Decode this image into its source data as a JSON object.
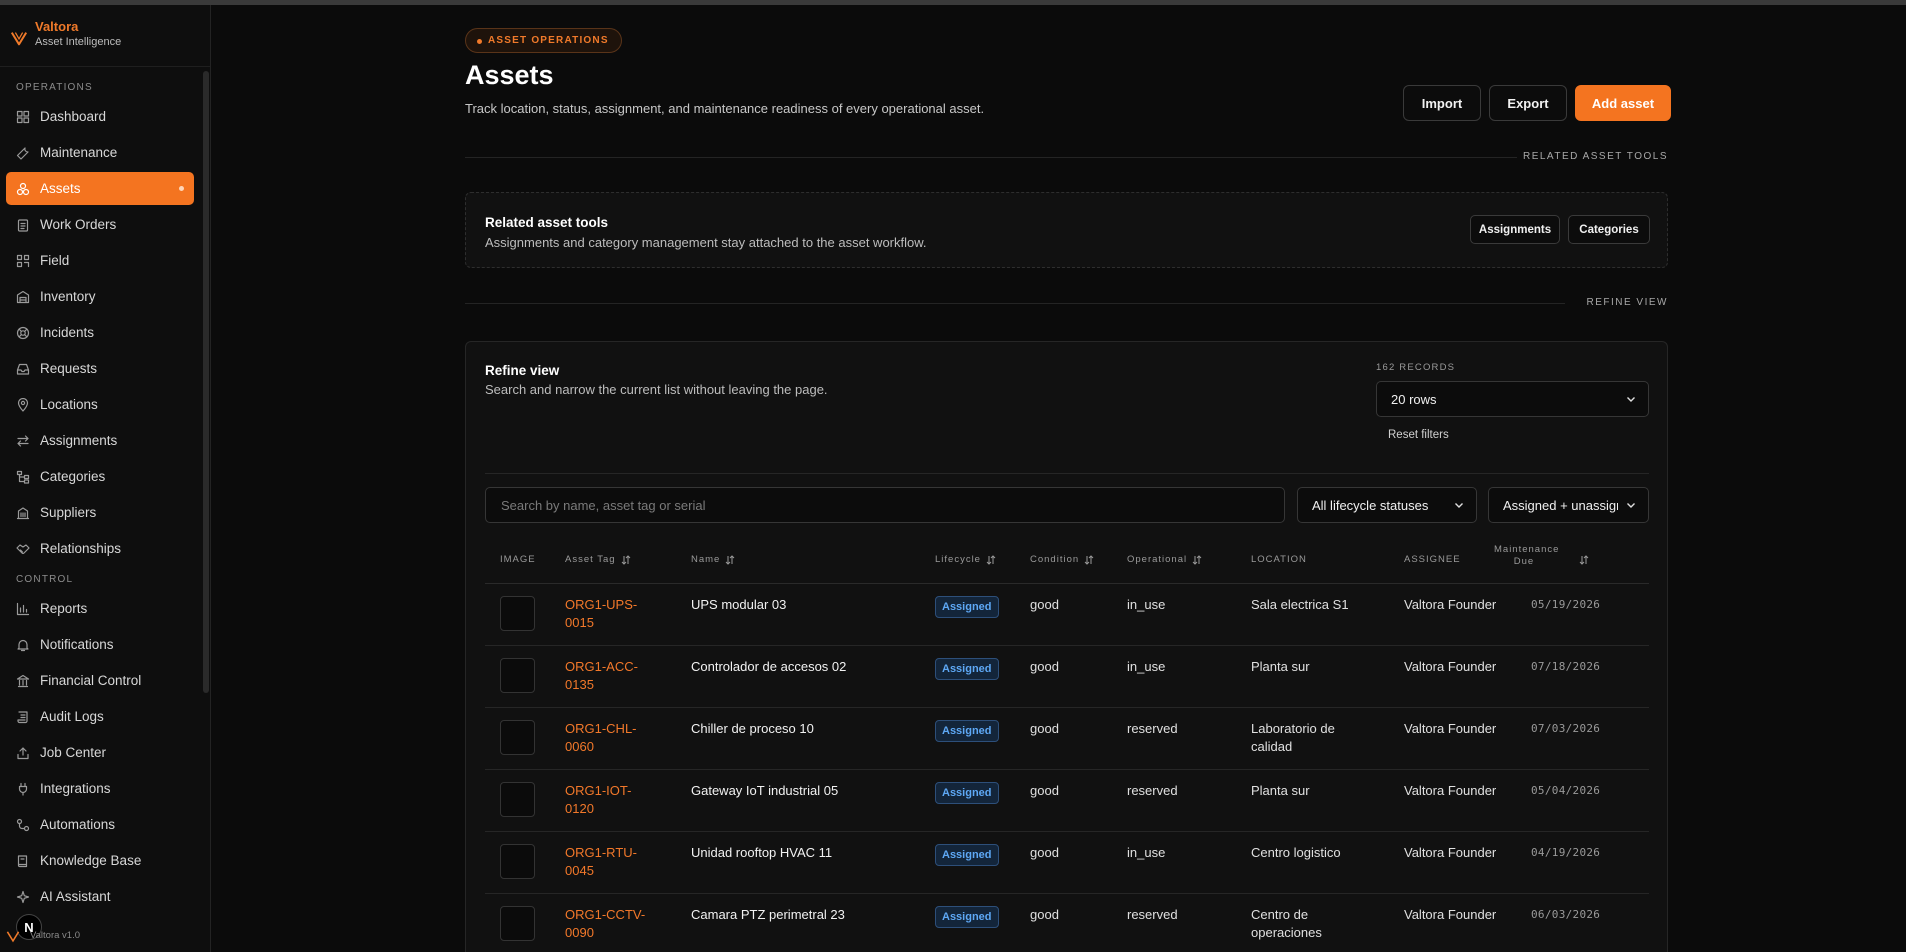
{
  "brand": {
    "name": "Valtora",
    "subtitle": "Asset Intelligence",
    "version": "Valtora v1.0",
    "accent": "#f47420"
  },
  "sidebar": {
    "sections": [
      {
        "label": "OPERATIONS",
        "items": [
          {
            "label": "Dashboard",
            "icon": "grid-icon"
          },
          {
            "label": "Maintenance",
            "icon": "wrench-icon"
          },
          {
            "label": "Assets",
            "icon": "boxes-icon",
            "active": true
          },
          {
            "label": "Work Orders",
            "icon": "clipboard-icon"
          },
          {
            "label": "Field",
            "icon": "qr-icon"
          },
          {
            "label": "Inventory",
            "icon": "warehouse-icon"
          },
          {
            "label": "Incidents",
            "icon": "lifebuoy-icon"
          },
          {
            "label": "Requests",
            "icon": "inbox-icon"
          },
          {
            "label": "Locations",
            "icon": "map-pin-icon"
          },
          {
            "label": "Assignments",
            "icon": "arrows-icon"
          },
          {
            "label": "Categories",
            "icon": "tree-icon"
          },
          {
            "label": "Suppliers",
            "icon": "building-icon"
          },
          {
            "label": "Relationships",
            "icon": "handshake-icon"
          }
        ]
      },
      {
        "label": "CONTROL",
        "items": [
          {
            "label": "Reports",
            "icon": "bar-chart-icon"
          },
          {
            "label": "Notifications",
            "icon": "bell-icon"
          },
          {
            "label": "Financial Control",
            "icon": "bank-icon"
          },
          {
            "label": "Audit Logs",
            "icon": "scroll-icon"
          },
          {
            "label": "Job Center",
            "icon": "upload-icon"
          },
          {
            "label": "Integrations",
            "icon": "plug-icon"
          },
          {
            "label": "Automations",
            "icon": "workflow-icon"
          },
          {
            "label": "Knowledge Base",
            "icon": "book-icon"
          },
          {
            "label": "AI Assistant",
            "icon": "sparkle-icon"
          }
        ]
      }
    ]
  },
  "header": {
    "eyebrow": "ASSET OPERATIONS",
    "title": "Assets",
    "subtitle": "Track location, status, assignment, and maintenance readiness of every operational asset.",
    "import_label": "Import",
    "export_label": "Export",
    "add_label": "Add asset"
  },
  "related_tools": {
    "section_label": "RELATED ASSET TOOLS",
    "title": "Related asset tools",
    "description": "Assignments and category management stay attached to the asset workflow.",
    "assignments_label": "Assignments",
    "categories_label": "Categories"
  },
  "refine": {
    "section_label": "REFINE VIEW",
    "title": "Refine view",
    "description": "Search and narrow the current list without leaving the page.",
    "records": "162 RECORDS",
    "rows_select": "20 rows",
    "reset_label": "Reset filters",
    "search_placeholder": "Search by name, asset tag or serial",
    "lifecycle_filter": "All lifecycle statuses",
    "assignment_filter": "Assigned + unassigned"
  },
  "table": {
    "columns": {
      "image": "IMAGE",
      "tag": "Asset Tag",
      "name": "Name",
      "lifecycle": "Lifecycle",
      "condition": "Condition",
      "operational": "Operational",
      "location": "LOCATION",
      "assignee": "ASSIGNEE",
      "maintenance": "Maintenance Due"
    },
    "rows": [
      {
        "tag": "ORG1-UPS-0015",
        "name": "UPS modular 03",
        "lifecycle": "Assigned",
        "condition": "good",
        "operational": "in_use",
        "location": "Sala electrica S1",
        "assignee": "Valtora Founder",
        "due": "05/19/2026"
      },
      {
        "tag": "ORG1-ACC-0135",
        "name": "Controlador de accesos 02",
        "lifecycle": "Assigned",
        "condition": "good",
        "operational": "in_use",
        "location": "Planta sur",
        "assignee": "Valtora Founder",
        "due": "07/18/2026"
      },
      {
        "tag": "ORG1-CHL-0060",
        "name": "Chiller de proceso 10",
        "lifecycle": "Assigned",
        "condition": "good",
        "operational": "reserved",
        "location": "Laboratorio de calidad",
        "assignee": "Valtora Founder",
        "due": "07/03/2026"
      },
      {
        "tag": "ORG1-IOT-0120",
        "name": "Gateway IoT industrial 05",
        "lifecycle": "Assigned",
        "condition": "good",
        "operational": "reserved",
        "location": "Planta sur",
        "assignee": "Valtora Founder",
        "due": "05/04/2026"
      },
      {
        "tag": "ORG1-RTU-0045",
        "name": "Unidad rooftop HVAC 11",
        "lifecycle": "Assigned",
        "condition": "good",
        "operational": "in_use",
        "location": "Centro logistico",
        "assignee": "Valtora Founder",
        "due": "04/19/2026"
      },
      {
        "tag": "ORG1-CCTV-0090",
        "name": "Camara PTZ perimetral 23",
        "lifecycle": "Assigned",
        "condition": "good",
        "operational": "reserved",
        "location": "Centro de operaciones",
        "assignee": "Valtora Founder",
        "due": "06/03/2026"
      }
    ]
  }
}
